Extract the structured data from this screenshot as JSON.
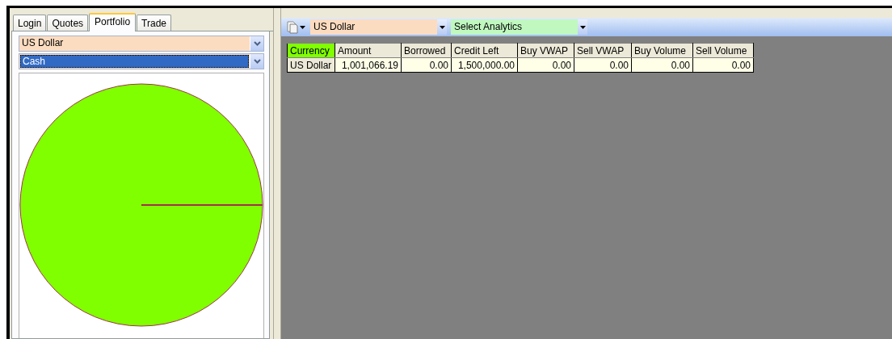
{
  "tabs": [
    {
      "label": "Login",
      "selected": false
    },
    {
      "label": "Quotes",
      "selected": false
    },
    {
      "label": "Portfolio",
      "selected": true
    },
    {
      "label": "Trade",
      "selected": false
    }
  ],
  "portfolio": {
    "dropdowns": [
      {
        "value": "US Dollar",
        "highlighted": false
      },
      {
        "value": "Cash",
        "highlighted": true
      }
    ]
  },
  "toolbar": {
    "currency_dropdown": "US Dollar",
    "analytics_dropdown": "Select Analytics"
  },
  "table": {
    "columns": [
      {
        "label": "Currency",
        "selected": true
      },
      {
        "label": "Amount",
        "selected": false
      },
      {
        "label": "Borrowed",
        "selected": false
      },
      {
        "label": "Credit Left",
        "selected": false
      },
      {
        "label": "Buy VWAP",
        "selected": false
      },
      {
        "label": "Sell VWAP",
        "selected": false
      },
      {
        "label": "Buy Volume",
        "selected": false
      },
      {
        "label": "Sell Volume",
        "selected": false
      }
    ],
    "rows": [
      [
        "US Dollar",
        "1,001,066.19",
        "0.00",
        "1,500,000.00",
        "0.00",
        "0.00",
        "0.00",
        "0.00"
      ]
    ]
  }
}
